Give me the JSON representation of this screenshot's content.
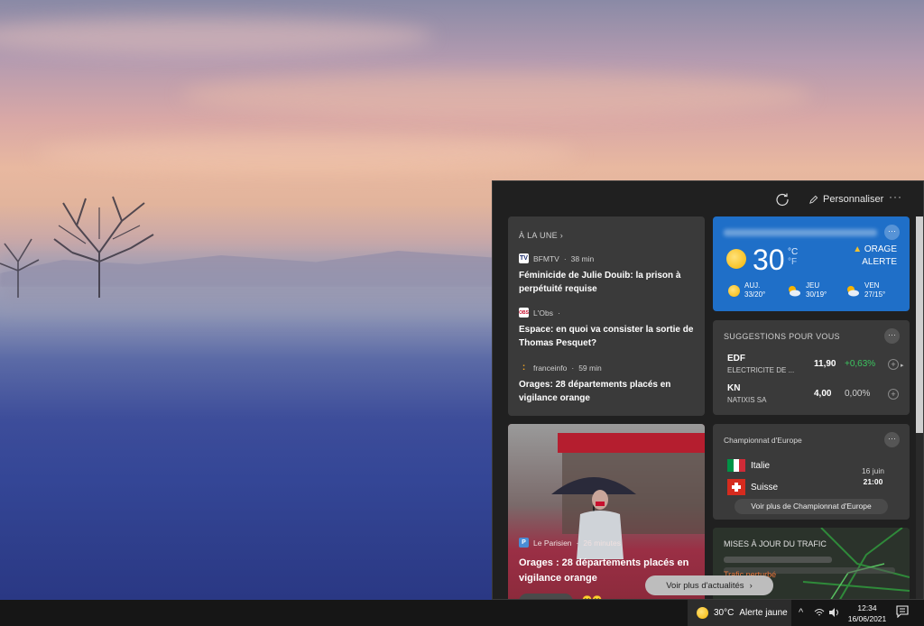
{
  "panel": {
    "personalize_label": "Personnaliser",
    "more_label": "···"
  },
  "top_news": {
    "header": "À LA UNE",
    "items": [
      {
        "source": "BFMTV",
        "age": "38 min",
        "title": "Féminicide de Julie Douib: la prison à perpétuité requise"
      },
      {
        "source": "L'Obs",
        "age": "",
        "title": "Espace: en quoi va consister la sortie de Thomas Pesquet?"
      },
      {
        "source": "franceinfo",
        "age": "59 min",
        "title": "Orages: 28 départements placés en vigilance orange"
      }
    ]
  },
  "feature_story": {
    "source": "Le Parisien",
    "age": "26 minutes",
    "title": "Orages : 28 départements placés en vigilance orange"
  },
  "weather": {
    "temp": "30",
    "unit_c": "°C",
    "unit_f": "°F",
    "alert_type": "ORAGE",
    "alert_label": "ALERTE",
    "forecast": [
      {
        "day": "AUJ.",
        "range": "33/20°",
        "icon": "sun-icon"
      },
      {
        "day": "JEU",
        "range": "30/19°",
        "icon": "cloud-sun-icon"
      },
      {
        "day": "VEN",
        "range": "27/15°",
        "icon": "cloud-sun-icon"
      }
    ]
  },
  "stocks": {
    "header": "SUGGESTIONS POUR VOUS",
    "items": [
      {
        "symbol": "EDF",
        "name": "ELECTRICITE DE ...",
        "price": "11,90",
        "change": "+0,63%",
        "color": "#3cc45f"
      },
      {
        "symbol": "KN",
        "name": "NATIXIS SA",
        "price": "4,00",
        "change": "0,00%",
        "color": "#d0d0d0"
      }
    ]
  },
  "football": {
    "header": "Championnat d'Europe",
    "team1": "Italie",
    "team2": "Suisse",
    "date": "16 juin",
    "time": "21:00",
    "more_button": "Voir plus de Championnat d'Europe"
  },
  "traffic": {
    "header": "MISES À JOUR DU TRAFIC",
    "status": "Trafic perturbé"
  },
  "more_news_button": "Voir plus d'actualités",
  "taskbar": {
    "weather_temp": "30°C",
    "weather_alert": "Alerte jaune",
    "time": "12:34",
    "date": "16/06/2021"
  },
  "colors": {
    "weather_card": "#1f6fc8",
    "positive": "#3cc45f",
    "alert_triangle": "#f2c12e"
  }
}
